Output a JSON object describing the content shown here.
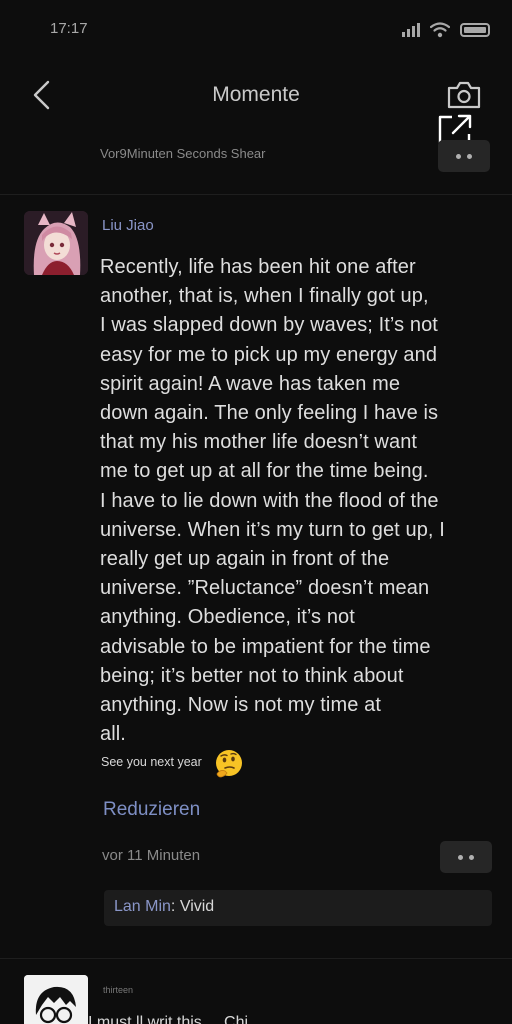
{
  "status_bar": {
    "time": "17:17",
    "icons": [
      "signal-icon",
      "wifi-icon",
      "battery-icon"
    ]
  },
  "header": {
    "title": "Momente",
    "back_icon": "chevron-left-icon",
    "camera_icon": "camera-icon"
  },
  "share_icon": "external-link-icon",
  "previous_post": {
    "meta": "Vor9Minuten Seconds Shear",
    "more_icon": "more-dots-icon"
  },
  "post": {
    "author": "Liu Jiao",
    "avatar": "avatar-pink-hair",
    "body_lines": [
      "Recently, life has been hit one after",
      "another, that is, when I finally got up,",
      "I was slapped down by waves; It’s not",
      "easy for me to pick up my energy and",
      "spirit again! A wave has taken me",
      "down again. The only feeling I have is",
      "that my his mother life doesn’t want",
      "me to get up at all for the time being.",
      "I have to lie down with the flood of the",
      "universe. When it’s my turn to get up, I",
      "really get up again in front of the",
      "universe. ”Reluctance” doesn’t mean",
      "anything. Obedience, it’s not",
      "advisable to be impatient for the time",
      "being; it’s better not to think about",
      "anything. Now is not my time at",
      "all."
    ],
    "sub_line": "See you next year",
    "emoji": "thinking-face-emoji",
    "collapse_label": "Reduzieren",
    "time": "vor 11 Minuten",
    "more_icon": "more-dots-icon",
    "comment": {
      "author": "Lan Min",
      "separator": ": ",
      "text": "Vivid"
    }
  },
  "next_post": {
    "label": "thirteen",
    "peek_text": "I must ll writ  this  ...  Chi"
  }
}
